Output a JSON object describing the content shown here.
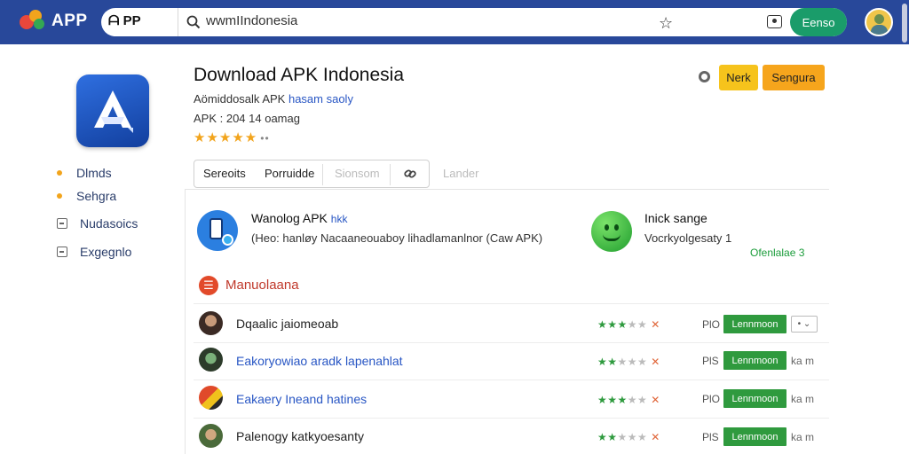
{
  "topbar": {
    "logo_text": "APP",
    "url_prefix": "ᗩ PP",
    "url_value": "wwmIIndonesia",
    "action_button": "Eenso",
    "colors": {
      "bar": "#28489a",
      "action": "#1a9c6a"
    }
  },
  "app": {
    "title": "Download APK Indonesia",
    "subtitle_prefix": "Aömiddosalk APK",
    "subtitle_highlight": "hasam saoly",
    "meta": "APK : 204 14 oamag",
    "rating_stars": "★★★★★",
    "rating_more": "••",
    "buttons": {
      "nerk": "Nerk",
      "sengura": "Sengura"
    }
  },
  "sidebar": {
    "items": [
      {
        "label": "Dlmds",
        "icon": "dot-icon"
      },
      {
        "label": "Sehgra",
        "icon": "dot-icon"
      },
      {
        "label": "Nudasoics",
        "icon": "box-icon"
      },
      {
        "label": "Exgegnlo",
        "icon": "box-icon"
      }
    ]
  },
  "tabs": {
    "items": [
      "Sereoits",
      "Porruidde",
      "Sionsom"
    ],
    "extra": "Lander"
  },
  "features": {
    "first": {
      "title": "Wanolog APK",
      "title_link": "hkk",
      "desc": "(Heo: hanløy Nacaaneouaboy lihadlamanlnor (Caw APK)"
    },
    "second": {
      "title": "Inick sange",
      "desc": "Vocrkyolgesaty 1",
      "link": "Ofenlalae 3"
    }
  },
  "section": {
    "icon_glyph": "☰",
    "title": "Manuolaana"
  },
  "rows": [
    {
      "name": "Dqaalic jaiomeoab",
      "name_color": "#222222",
      "stars_on": "★★★",
      "stars_off": "★★",
      "mark": "✕",
      "size": "PlO",
      "button": "Lennmoon",
      "extra": "• ⌄"
    },
    {
      "name": "Eakoryowiao aradk lapenahlat",
      "name_color": "#2856c4",
      "stars_on": "★★",
      "stars_off": "★★★",
      "mark": "✕",
      "size": "PlS",
      "button": "Lennmoon",
      "extra": "ka m"
    },
    {
      "name": "Eakaery Ineand hatines",
      "name_color": "#2856c4",
      "stars_on": "★★★",
      "stars_off": "★★",
      "mark": "✕",
      "size": "PlO",
      "button": "Lennmoon",
      "extra": "ka m"
    },
    {
      "name": "Palenogy katkyoesanty",
      "name_color": "#222222",
      "stars_on": "★★",
      "stars_off": "★★★",
      "mark": "✕",
      "size": "PlS",
      "button": "Lennmoon",
      "extra": "ka m"
    }
  ]
}
